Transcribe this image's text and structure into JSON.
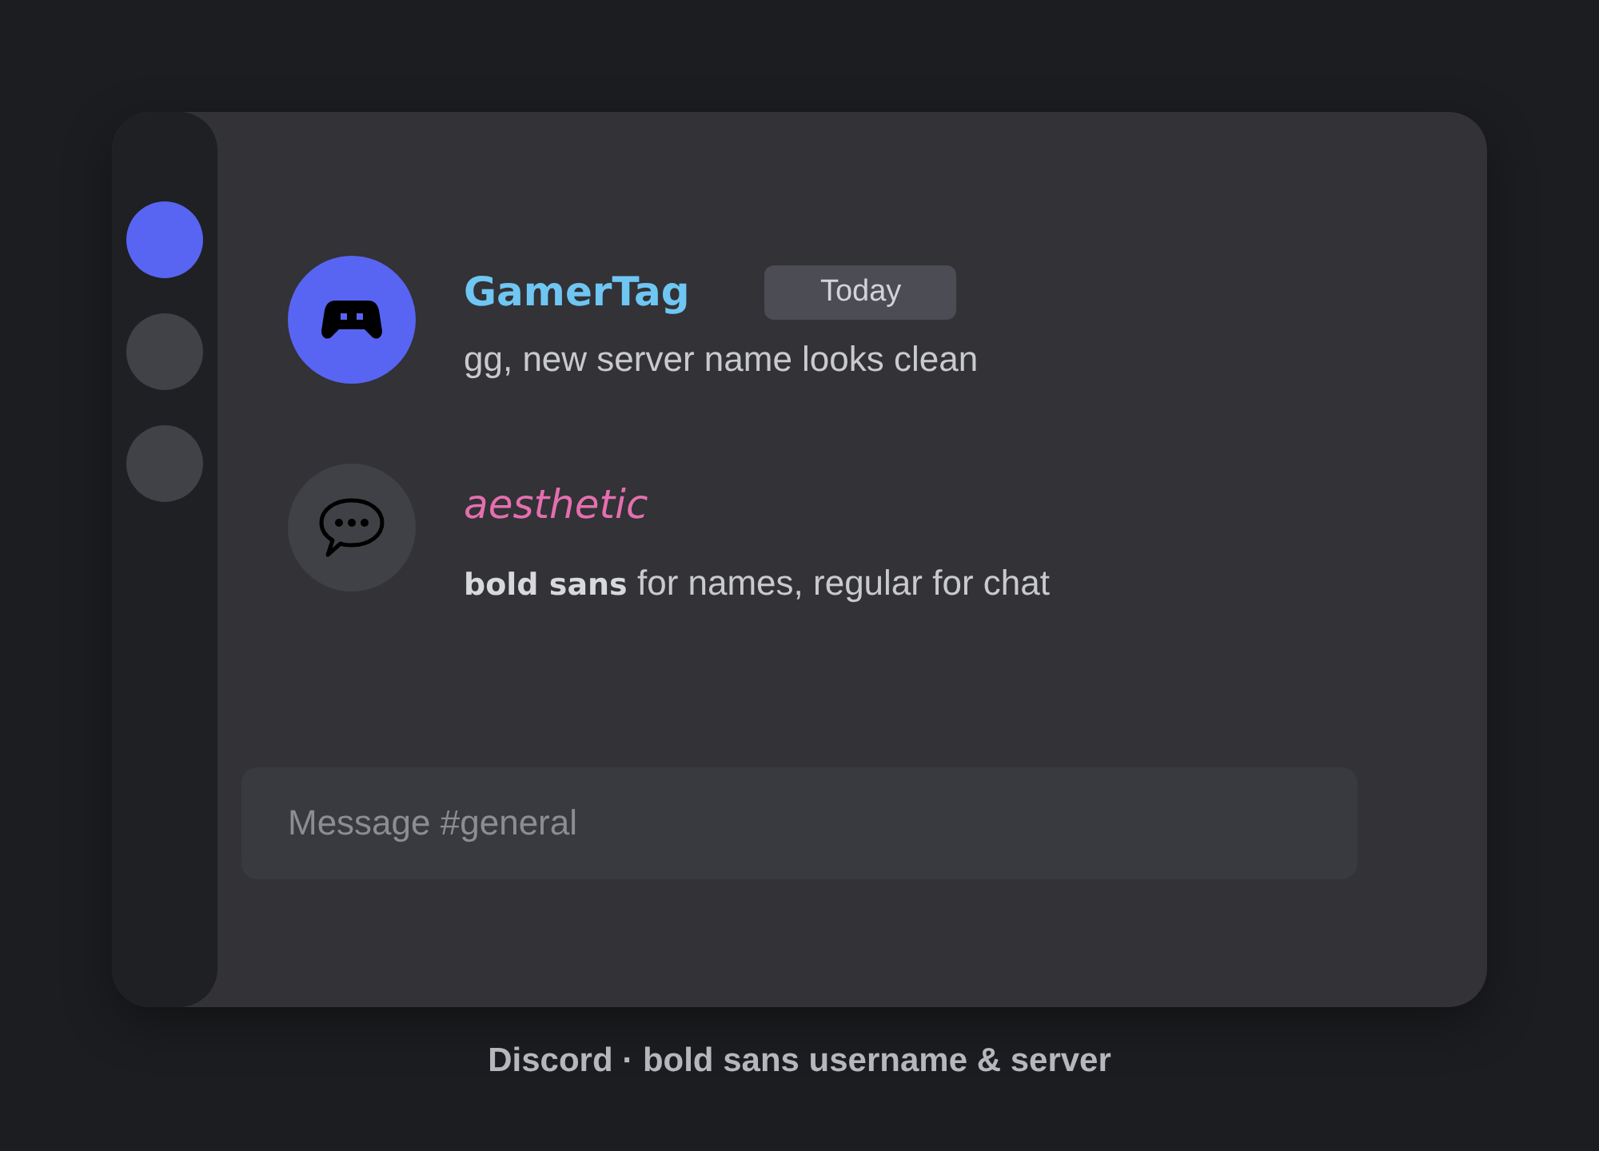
{
  "servers": [
    {
      "selected": true
    },
    {
      "selected": false
    },
    {
      "selected": false
    }
  ],
  "messages": [
    {
      "kind": "bold",
      "author": "GamerTag",
      "color": "#6fc6f2",
      "badge": "Today",
      "text": "gg, new server name looks clean",
      "avatar": {
        "color": "#5865f2"
      }
    },
    {
      "kind": "italic",
      "author": "aesthetic",
      "color": "#e56fae",
      "text": "**bold sans** for names, regular for chat",
      "avatar": {
        "color": "#404146"
      }
    }
  ],
  "composer": {
    "placeholder": "Message #general"
  },
  "caption": "Discord · bold sans username & server"
}
